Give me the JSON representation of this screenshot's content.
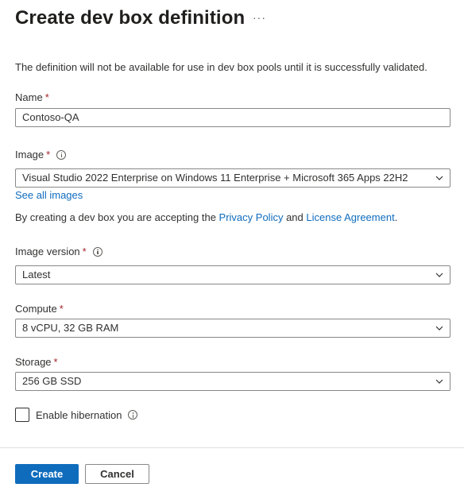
{
  "header": {
    "title": "Create dev box definition",
    "more_label": "···"
  },
  "notice": "The definition will not be available for use in dev box pools until it is successfully validated.",
  "name_field": {
    "label": "Name",
    "required_mark": "*",
    "value": "Contoso-QA"
  },
  "image_field": {
    "label": "Image",
    "required_mark": "*",
    "value": "Visual Studio 2022 Enterprise on Windows 11 Enterprise + Microsoft 365 Apps 22H2",
    "see_all_link": "See all images"
  },
  "consent": {
    "prefix": "By creating a dev box you are accepting the ",
    "privacy_link": "Privacy Policy",
    "and_text": " and ",
    "license_link": "License Agreement",
    "suffix": "."
  },
  "image_version_field": {
    "label": "Image version",
    "required_mark": "*",
    "value": "Latest"
  },
  "compute_field": {
    "label": "Compute",
    "required_mark": "*",
    "value": "8 vCPU, 32 GB RAM"
  },
  "storage_field": {
    "label": "Storage",
    "required_mark": "*",
    "value": "256 GB SSD"
  },
  "hibernation": {
    "label": "Enable hibernation",
    "checked": false
  },
  "footer": {
    "create_label": "Create",
    "cancel_label": "Cancel"
  },
  "colors": {
    "accent": "#0f6cbd",
    "required": "#a4262c",
    "border": "#8a8886",
    "text": "#323130"
  }
}
